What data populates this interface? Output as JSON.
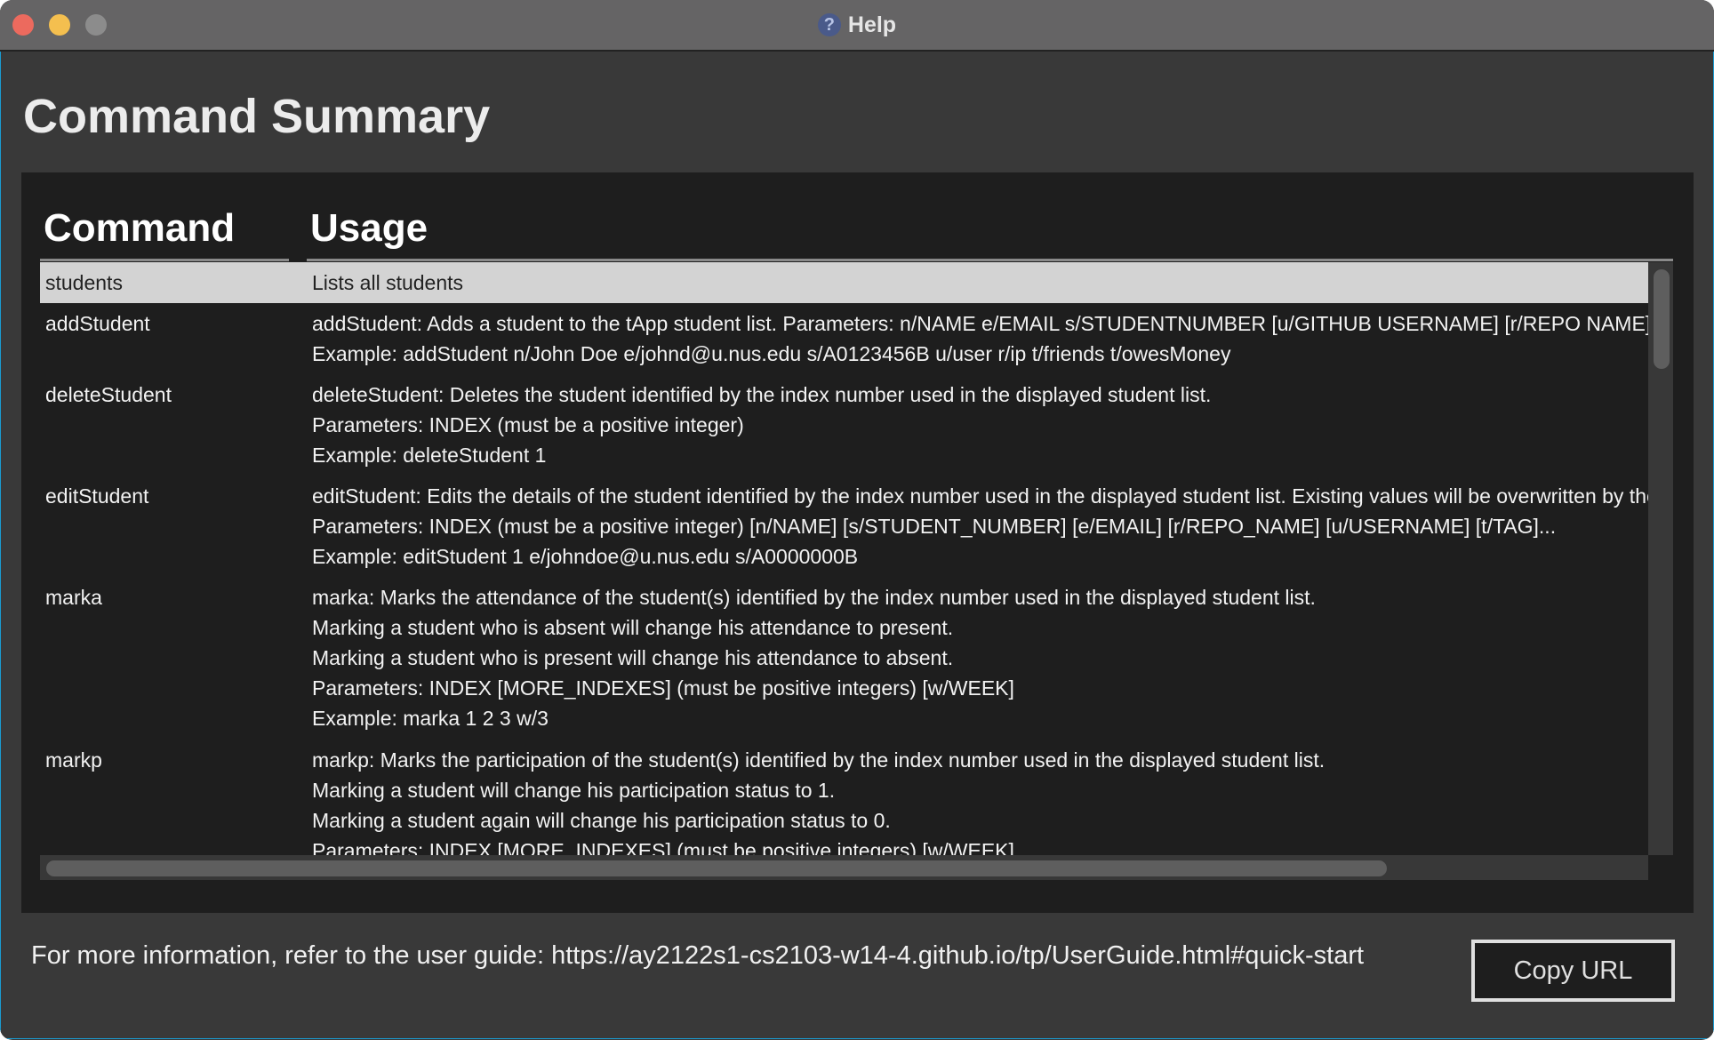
{
  "window": {
    "title": "Help",
    "title_icon": "question-icon",
    "traffic_lights": {
      "close": "#ec6a5e",
      "minimize": "#f4bf4f",
      "maximize": "#8c8c8c"
    }
  },
  "heading": "Command Summary",
  "table": {
    "columns": [
      "Command",
      "Usage"
    ],
    "rows": [
      {
        "command": "students",
        "usage": [
          "Lists all students"
        ],
        "selected": true
      },
      {
        "command": "addStudent",
        "usage": [
          "addStudent: Adds a student to the tApp student list. Parameters: n/NAME e/EMAIL s/STUDENTNUMBER [u/GITHUB USERNAME] [r/REPO NAME] [t/TAG]...",
          "Example: addStudent n/John Doe e/johnd@u.nus.edu s/A0123456B u/user r/ip t/friends t/owesMoney"
        ]
      },
      {
        "command": "deleteStudent",
        "usage": [
          "deleteStudent: Deletes the student identified by the index number used in the displayed student list.",
          "Parameters: INDEX (must be a positive integer)",
          "Example: deleteStudent 1"
        ]
      },
      {
        "command": "editStudent",
        "usage": [
          "editStudent: Edits the details of the student identified by the index number used in the displayed student list. Existing values will be overwritten by the input values.",
          "Parameters: INDEX (must be a positive integer) [n/NAME] [s/STUDENT_NUMBER] [e/EMAIL] [r/REPO_NAME] [u/USERNAME] [t/TAG]...",
          "Example: editStudent 1 e/johndoe@u.nus.edu s/A0000000B"
        ]
      },
      {
        "command": "marka",
        "usage": [
          "marka: Marks the attendance of the student(s) identified by the index number used in the displayed student list.",
          "Marking a student who is absent will change his attendance to present.",
          "Marking a student who is present will change his attendance to absent.",
          "Parameters: INDEX [MORE_INDEXES] (must be positive integers) [w/WEEK]",
          "Example: marka 1 2 3 w/3"
        ]
      },
      {
        "command": "markp",
        "usage": [
          "markp: Marks the participation of the student(s) identified by the index number used in the displayed student list.",
          "Marking a student will change his participation status to 1.",
          "Marking a student again will change his participation status to 0.",
          "Parameters: INDEX [MORE_INDEXES] (must be positive integers) [w/WEEK]"
        ]
      }
    ]
  },
  "footer": {
    "text": "For more information, refer to the user guide: https://ay2122s1-cs2103-w14-4.github.io/tp/UserGuide.html#quick-start",
    "copy_button": "Copy URL"
  }
}
